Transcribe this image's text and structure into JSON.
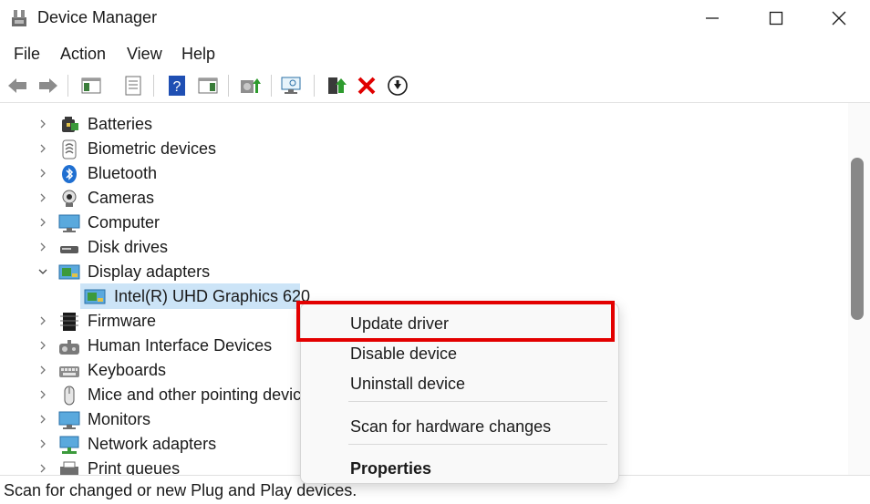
{
  "window": {
    "title": "Device Manager"
  },
  "menu": {
    "items": [
      "File",
      "Action",
      "View",
      "Help"
    ]
  },
  "toolbar": {
    "icons": [
      "back-icon",
      "forward-icon",
      "show-hide-console-tree-icon",
      "properties-icon",
      "help-icon",
      "action-pane-icon",
      "update-driver-icon",
      "scan-hardware-icon",
      "enable-device-icon",
      "uninstall-icon",
      "disable-device-icon"
    ]
  },
  "tree": {
    "categories": [
      {
        "label": "Batteries",
        "expanded": false
      },
      {
        "label": "Biometric devices",
        "expanded": false
      },
      {
        "label": "Bluetooth",
        "expanded": false
      },
      {
        "label": "Cameras",
        "expanded": false
      },
      {
        "label": "Computer",
        "expanded": false
      },
      {
        "label": "Disk drives",
        "expanded": false
      },
      {
        "label": "Display adapters",
        "expanded": true
      },
      {
        "label": "Firmware",
        "expanded": false
      },
      {
        "label": "Human Interface Devices",
        "expanded": false
      },
      {
        "label": "Keyboards",
        "expanded": false
      },
      {
        "label": "Mice and other pointing devices",
        "expanded": false
      },
      {
        "label": "Monitors",
        "expanded": false
      },
      {
        "label": "Network adapters",
        "expanded": false
      },
      {
        "label": "Print queues",
        "expanded": false
      }
    ],
    "child": {
      "label": "Intel(R) UHD Graphics 620",
      "selected": true
    }
  },
  "context_menu": {
    "items": [
      "Update driver",
      "Disable device",
      "Uninstall device",
      "Scan for hardware changes",
      "Properties"
    ],
    "highlight_color": "#e30000"
  },
  "status": {
    "text": "Scan for changed or new Plug and Play devices."
  }
}
